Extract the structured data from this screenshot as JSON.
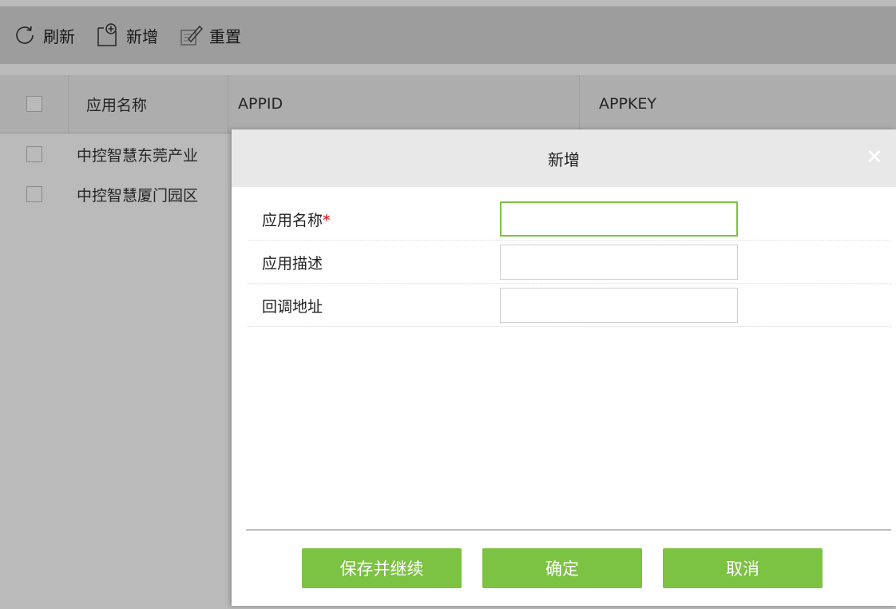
{
  "toolbar": {
    "refresh_label": "刷新",
    "add_label": "新增",
    "reset_label": "重置"
  },
  "table": {
    "columns": [
      "应用名称",
      "APPID",
      "APPKEY"
    ],
    "rows": [
      {
        "name": "中控智慧东莞产业"
      },
      {
        "name": "中控智慧厦门园区"
      }
    ]
  },
  "dialog": {
    "title": "新增",
    "close_icon": "close-icon",
    "fields": [
      {
        "label": "应用名称",
        "required_mark": "*",
        "value": ""
      },
      {
        "label": "应用描述",
        "value": ""
      },
      {
        "label": "回调地址",
        "value": ""
      }
    ],
    "buttons": {
      "save_continue": "保存并继续",
      "confirm": "确定",
      "cancel": "取消"
    }
  },
  "colors": {
    "accent": "#7cc243",
    "toolbar_bg": "#d8d8d8",
    "required": "#dd0000"
  }
}
